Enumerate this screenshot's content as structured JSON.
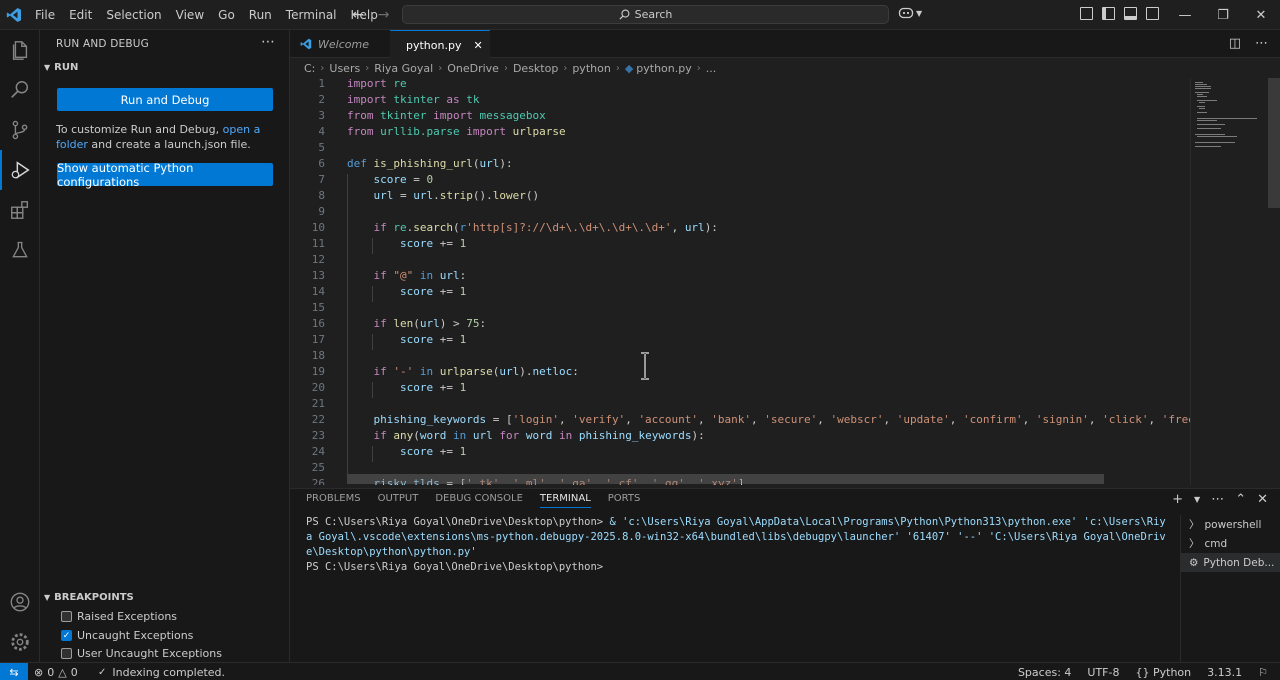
{
  "titlebar": {
    "menu": [
      "File",
      "Edit",
      "Selection",
      "View",
      "Go",
      "Run",
      "Terminal",
      "Help"
    ],
    "search_placeholder": "Search"
  },
  "sidebar": {
    "title": "RUN AND DEBUG",
    "run_section": "RUN",
    "run_debug_button": "Run and Debug",
    "customize_text_1": "To customize Run and Debug, ",
    "customize_link": "open a folder",
    "customize_text_2": " and create a launch.json file.",
    "python_config_button": "Show automatic Python configurations",
    "breakpoints_section": "BREAKPOINTS",
    "breakpoints": [
      {
        "label": "Raised Exceptions",
        "checked": false
      },
      {
        "label": "Uncaught Exceptions",
        "checked": true
      },
      {
        "label": "User Uncaught Exceptions",
        "checked": false
      }
    ]
  },
  "tabs": {
    "welcome": "Welcome",
    "active": "python.py"
  },
  "breadcrumb": [
    "C:",
    "Users",
    "Riya Goyal",
    "OneDrive",
    "Desktop",
    "python",
    "python.py",
    "..."
  ],
  "code": [
    {
      "n": "1",
      "html": "<span class=\"kw2\">import</span> <span class=\"cls\">re</span>"
    },
    {
      "n": "2",
      "html": "<span class=\"kw2\">import</span> <span class=\"cls\">tkinter</span> <span class=\"kw2\">as</span> <span class=\"cls\">tk</span>"
    },
    {
      "n": "3",
      "html": "<span class=\"kw2\">from</span> <span class=\"cls\">tkinter</span> <span class=\"kw2\">import</span> <span class=\"cls\">messagebox</span>"
    },
    {
      "n": "4",
      "html": "<span class=\"kw2\">from</span> <span class=\"cls\">urllib.parse</span> <span class=\"kw2\">import</span> <span class=\"fn\">urlparse</span>"
    },
    {
      "n": "5",
      "html": ""
    },
    {
      "n": "6",
      "html": "<span class=\"kw\">def</span> <span class=\"fn\">is_phishing_url</span>(<span class=\"var\">url</span>):"
    },
    {
      "n": "7",
      "html": "    <span class=\"var\">score</span> = <span class=\"num\">0</span>"
    },
    {
      "n": "8",
      "html": "    <span class=\"var\">url</span> = <span class=\"var\">url</span>.<span class=\"fn\">strip</span>().<span class=\"fn\">lower</span>()"
    },
    {
      "n": "9",
      "html": ""
    },
    {
      "n": "10",
      "html": "    <span class=\"kw2\">if</span> <span class=\"cls\">re</span>.<span class=\"fn\">search</span>(<span class=\"kw\">r</span><span class=\"str\">'http[s]?://\\d+\\.\\d+\\.\\d+\\.\\d+'</span>, <span class=\"var\">url</span>):"
    },
    {
      "n": "11",
      "html": "        <span class=\"var\">score</span> += <span class=\"num\">1</span>"
    },
    {
      "n": "12",
      "html": ""
    },
    {
      "n": "13",
      "html": "    <span class=\"kw2\">if</span> <span class=\"str\">\"@\"</span> <span class=\"kw\">in</span> <span class=\"var\">url</span>:"
    },
    {
      "n": "14",
      "html": "        <span class=\"var\">score</span> += <span class=\"num\">1</span>"
    },
    {
      "n": "15",
      "html": ""
    },
    {
      "n": "16",
      "html": "    <span class=\"kw2\">if</span> <span class=\"fn\">len</span>(<span class=\"var\">url</span>) > <span class=\"num\">75</span>:"
    },
    {
      "n": "17",
      "html": "        <span class=\"var\">score</span> += <span class=\"num\">1</span>"
    },
    {
      "n": "18",
      "html": ""
    },
    {
      "n": "19",
      "html": "    <span class=\"kw2\">if</span> <span class=\"str\">'-'</span> <span class=\"kw\">in</span> <span class=\"fn\">urlparse</span>(<span class=\"var\">url</span>).<span class=\"var\">netloc</span>:"
    },
    {
      "n": "20",
      "html": "        <span class=\"var\">score</span> += <span class=\"num\">1</span>"
    },
    {
      "n": "21",
      "html": ""
    },
    {
      "n": "22",
      "html": "    <span class=\"var\">phishing_keywords</span> = [<span class=\"str\">'login'</span>, <span class=\"str\">'verify'</span>, <span class=\"str\">'account'</span>, <span class=\"str\">'bank'</span>, <span class=\"str\">'secure'</span>, <span class=\"str\">'webscr'</span>, <span class=\"str\">'update'</span>, <span class=\"str\">'confirm'</span>, <span class=\"str\">'signin'</span>, <span class=\"str\">'click'</span>, <span class=\"str\">'free'</span>,"
    },
    {
      "n": "23",
      "html": "    <span class=\"kw2\">if</span> <span class=\"fn\">any</span>(<span class=\"var\">word</span> <span class=\"kw\">in</span> <span class=\"var\">url</span> <span class=\"kw2\">for</span> <span class=\"var\">word</span> <span class=\"kw2\">in</span> <span class=\"var\">phishing_keywords</span>):"
    },
    {
      "n": "24",
      "html": "        <span class=\"var\">score</span> += <span class=\"num\">1</span>"
    },
    {
      "n": "25",
      "html": ""
    },
    {
      "n": "26",
      "html": "    <span class=\"var\">risky_tlds</span> = [<span class=\"str\">'.tk'</span>, <span class=\"str\">'.ml'</span>, <span class=\"str\">'.ga'</span>, <span class=\"str\">'.cf'</span>, <span class=\"str\">'.gq'</span>, <span class=\"str\">'.xyz'</span>]"
    }
  ],
  "panel": {
    "tabs": [
      "PROBLEMS",
      "OUTPUT",
      "DEBUG CONSOLE",
      "TERMINAL",
      "PORTS"
    ],
    "active_tab": "TERMINAL",
    "prompt": "PS C:\\Users\\Riya Goyal\\OneDrive\\Desktop\\python>",
    "command": " & 'c:\\Users\\Riya Goyal\\AppData\\Local\\Programs\\Python\\Python313\\python.exe' 'c:\\Users\\Riya Goyal\\.vscode\\extensions\\ms-python.debugpy-2025.8.0-win32-x64\\bundled\\libs\\debugpy\\launcher' '61407' '--' 'C:\\Users\\Riya Goyal\\OneDrive\\Desktop\\python\\python.py'",
    "prompt2": "PS C:\\Users\\Riya Goyal\\OneDrive\\Desktop\\python>",
    "terminals": [
      "powershell",
      "cmd",
      "Python Deb..."
    ]
  },
  "status": {
    "errors": "0",
    "warnings": "0",
    "indexing": "Indexing completed.",
    "spaces": "Spaces: 4",
    "encoding": "UTF-8",
    "language": "Python",
    "version": "3.13.1"
  },
  "colors": {
    "accent": "#0078d4",
    "background": "#1f1f1f"
  }
}
